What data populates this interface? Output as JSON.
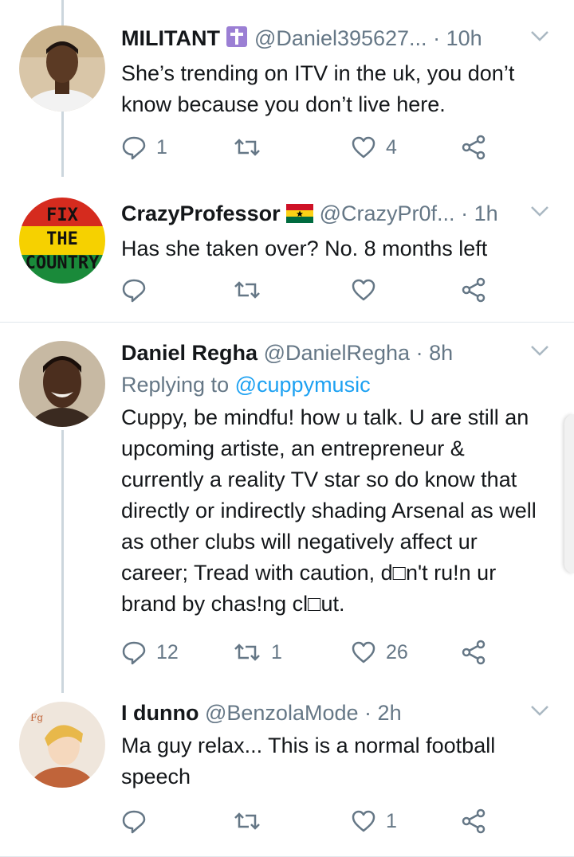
{
  "tweets": [
    {
      "name": "MILITANT",
      "name_badge": "cross-icon",
      "handle": "@Daniel395627...",
      "time": "10h",
      "text": "She’s trending on ITV in the uk, you don’t know because you don’t live here.",
      "reply_count": "1",
      "retweet_count": "",
      "like_count": "4"
    },
    {
      "name": "CrazyProfessor",
      "name_badge": "ghana-flag-icon",
      "handle": "@CrazyPr0f...",
      "time": "1h",
      "text": "Has she taken over? No. 8 months left",
      "avatar_text": [
        "FIX",
        "THE",
        "COUNTRY"
      ],
      "reply_count": "",
      "retweet_count": "",
      "like_count": ""
    },
    {
      "name": "Daniel Regha",
      "handle": "@DanielRegha",
      "time": "8h",
      "replying_prefix": "Replying to",
      "replying_to": "@cuppymusic",
      "text": "Cuppy, be mindfu! how u talk. U are still an upcoming artiste, an entrepreneur & currently a reality TV star so do know that directly or indirectly shading Arsenal as well as other clubs will negatively affect ur career; Tread with caution, d□n't ru!n ur brand by chas!ng cl□ut.",
      "reply_count": "12",
      "retweet_count": "1",
      "like_count": "26"
    },
    {
      "name": "I dunno",
      "handle": "@BenzolaMode",
      "time": "2h",
      "text": "Ma guy relax...  This is a normal football speech",
      "reply_count": "",
      "retweet_count": "",
      "like_count": "1"
    }
  ],
  "colors": {
    "meta": "#657786",
    "link": "#1da1f2",
    "icon": "#657786",
    "divider": "#e1e8ed"
  }
}
